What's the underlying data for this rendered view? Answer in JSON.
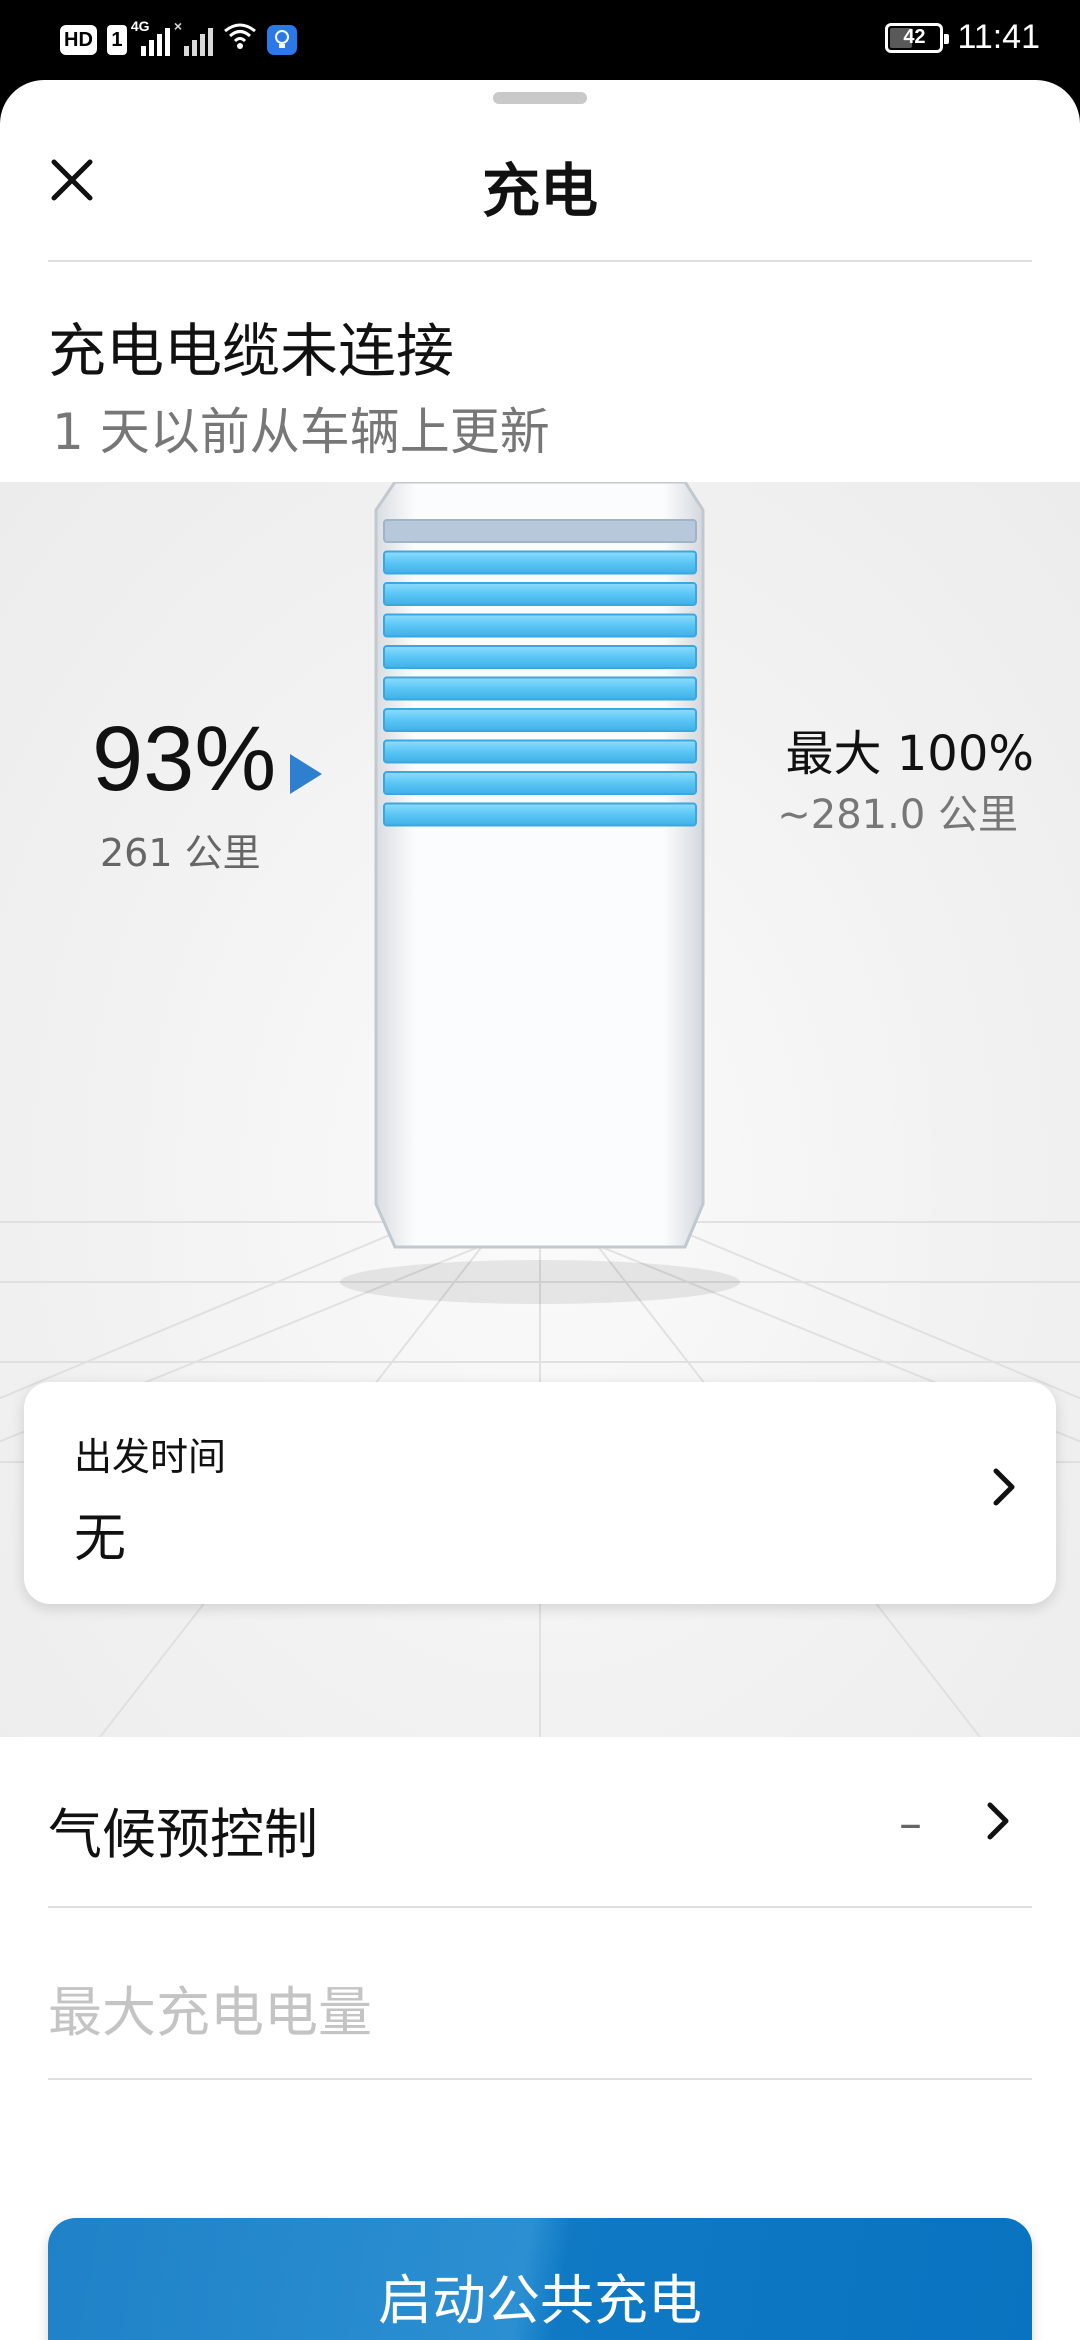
{
  "status_bar": {
    "hd": "HD",
    "sim": "1",
    "net_1": "4G",
    "net_2": "×",
    "battery": "42",
    "time": "11:41"
  },
  "header": {
    "title": "充电",
    "close_icon": "close-icon"
  },
  "charging_status": {
    "title": "充电电缆未连接",
    "subtitle": "1 天以前从车辆上更新"
  },
  "battery": {
    "percent_label": "93%",
    "percent_value": 93,
    "range_label": "261 公里",
    "max_label": "最大 100%",
    "max_range_label": "~281.0 公里",
    "bar_count": 10,
    "filled_bars": 9,
    "bar_color": "#5bc6f5",
    "arrow_color": "#2f7fcf"
  },
  "departure": {
    "label": "出发时间",
    "value": "无"
  },
  "climate": {
    "label": "气候预控制",
    "value": "–"
  },
  "max_charge": {
    "label": "最大充电电量"
  },
  "start_button": {
    "label": "启动公共充电",
    "color": "#1a7fc6"
  }
}
